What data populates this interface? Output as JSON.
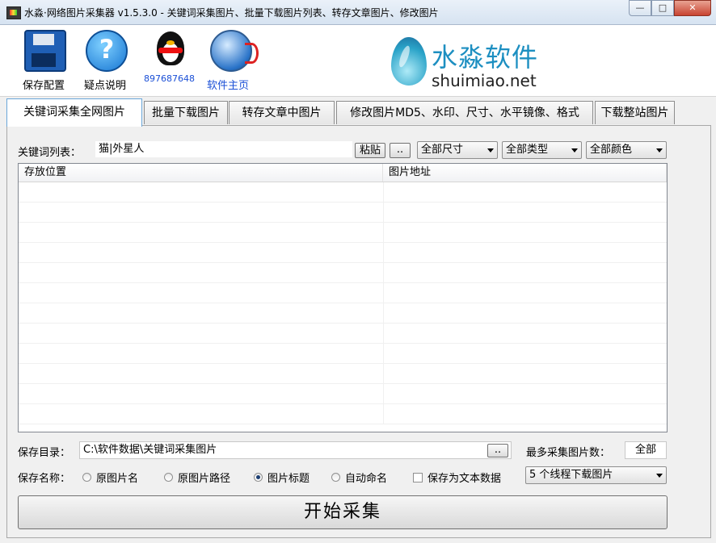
{
  "window": {
    "title": "水淼·网络图片采集器 v1.5.3.0 - 关键词采集图片、批量下载图片列表、转存文章图片、修改图片",
    "controls": {
      "minimize": "—",
      "maximize": "□",
      "close": "✕"
    }
  },
  "toolbar": {
    "items": [
      {
        "label": "保存配置",
        "icon": "floppy-disk-icon"
      },
      {
        "label": "疑点说明",
        "icon": "help-icon"
      },
      {
        "label": "897687648",
        "icon": "qq-penguin-icon",
        "color": "#1a4fd6"
      },
      {
        "label": "软件主页",
        "icon": "globe-icon",
        "color": "#1a4fd6"
      }
    ]
  },
  "brand": {
    "cn": "水淼软件",
    "en": "shuimiao.net"
  },
  "tabs": [
    {
      "label": "关键词采集全网图片",
      "active": true
    },
    {
      "label": "批量下载图片"
    },
    {
      "label": "转存文章中图片"
    },
    {
      "label": "修改图片MD5、水印、尺寸、水平镜像、格式"
    },
    {
      "label": "下载整站图片"
    }
  ],
  "keywords": {
    "label": "关键词列表：",
    "value": "猫|外星人",
    "paste_button": "粘贴",
    "browse_button": ".."
  },
  "filters": {
    "size": "全部尺寸",
    "type": "全部类型",
    "color": "全部颜色"
  },
  "grid": {
    "columns": [
      "存放位置",
      "图片地址"
    ],
    "rows": []
  },
  "save_dir": {
    "label": "保存目录：",
    "value": "C:\\软件数据\\关键词采集图片",
    "browse_button": ".."
  },
  "max_count": {
    "label": "最多采集图片数：",
    "value": "全部"
  },
  "save_name": {
    "label": "保存名称：",
    "options": [
      {
        "label": "原图片名",
        "checked": false
      },
      {
        "label": "原图片路径",
        "checked": false
      },
      {
        "label": "图片标题",
        "checked": true
      },
      {
        "label": "自动命名",
        "checked": false
      }
    ],
    "save_as_text": {
      "label": "保存为文本数据",
      "checked": false
    }
  },
  "threads": {
    "value": "5 个线程下载图片"
  },
  "start_button": "开始采集",
  "colors": {
    "brand_blue": "#1d8fc1",
    "link_blue": "#1a4fd6"
  }
}
